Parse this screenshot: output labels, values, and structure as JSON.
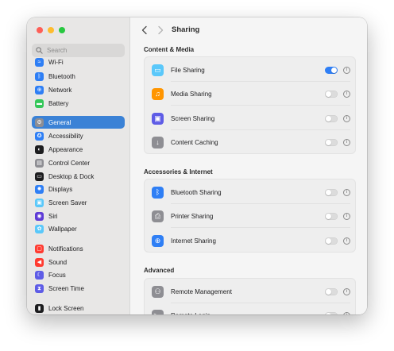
{
  "window": {
    "title": "Sharing"
  },
  "search": {
    "placeholder": "Search"
  },
  "sidebar": {
    "items": [
      {
        "label": "Wi-Fi",
        "icon": "wifi-icon",
        "color": "#2f7ff5",
        "glyph": "≈"
      },
      {
        "label": "Bluetooth",
        "icon": "bluetooth-icon",
        "color": "#2f7ff5",
        "glyph": "ᛒ"
      },
      {
        "label": "Network",
        "icon": "network-icon",
        "color": "#2f7ff5",
        "glyph": "⊕"
      },
      {
        "label": "Battery",
        "icon": "battery-icon",
        "color": "#34c759",
        "glyph": "▬"
      },
      {
        "label": "General",
        "icon": "gear-icon",
        "color": "#8e8e93",
        "glyph": "⚙",
        "selected": true
      },
      {
        "label": "Accessibility",
        "icon": "accessibility-icon",
        "color": "#2f7ff5",
        "glyph": "✪"
      },
      {
        "label": "Appearance",
        "icon": "appearance-icon",
        "color": "#1d1d1f",
        "glyph": "◐"
      },
      {
        "label": "Control Center",
        "icon": "control-center-icon",
        "color": "#8e8e93",
        "glyph": "▤"
      },
      {
        "label": "Desktop & Dock",
        "icon": "desktop-dock-icon",
        "color": "#1d1d1f",
        "glyph": "▭"
      },
      {
        "label": "Displays",
        "icon": "displays-icon",
        "color": "#2f7ff5",
        "glyph": "✹"
      },
      {
        "label": "Screen Saver",
        "icon": "screen-saver-icon",
        "color": "#5ac8fa",
        "glyph": "▣"
      },
      {
        "label": "Siri",
        "icon": "siri-icon",
        "color": "#5e3bd6",
        "glyph": "◉"
      },
      {
        "label": "Wallpaper",
        "icon": "wallpaper-icon",
        "color": "#5ac8fa",
        "glyph": "✿"
      },
      {
        "label": "Notifications",
        "icon": "notifications-icon",
        "color": "#ff3b30",
        "glyph": "▢"
      },
      {
        "label": "Sound",
        "icon": "sound-icon",
        "color": "#ff3b30",
        "glyph": "◀"
      },
      {
        "label": "Focus",
        "icon": "focus-icon",
        "color": "#5e5ce6",
        "glyph": "☾"
      },
      {
        "label": "Screen Time",
        "icon": "screen-time-icon",
        "color": "#5e5ce6",
        "glyph": "⧗"
      },
      {
        "label": "Lock Screen",
        "icon": "lock-screen-icon",
        "color": "#1d1d1f",
        "glyph": "▮"
      }
    ]
  },
  "sections": [
    {
      "title": "Content & Media",
      "rows": [
        {
          "label": "File Sharing",
          "icon": "folder-icon",
          "color": "#5ac8fa",
          "glyph": "▭",
          "on": true
        },
        {
          "label": "Media Sharing",
          "icon": "media-sharing-icon",
          "color": "#ff9500",
          "glyph": "♫",
          "on": false
        },
        {
          "label": "Screen Sharing",
          "icon": "screen-sharing-icon",
          "color": "#5e5ce6",
          "glyph": "▣",
          "on": false
        },
        {
          "label": "Content Caching",
          "icon": "content-caching-icon",
          "color": "#8e8e93",
          "glyph": "↓",
          "on": false
        }
      ]
    },
    {
      "title": "Accessories & Internet",
      "rows": [
        {
          "label": "Bluetooth Sharing",
          "icon": "bluetooth-icon",
          "color": "#2f7ff5",
          "glyph": "ᛒ",
          "on": false
        },
        {
          "label": "Printer Sharing",
          "icon": "printer-icon",
          "color": "#8e8e93",
          "glyph": "⎙",
          "on": false
        },
        {
          "label": "Internet Sharing",
          "icon": "globe-icon",
          "color": "#2f7ff5",
          "glyph": "⊕",
          "on": false
        }
      ]
    },
    {
      "title": "Advanced",
      "rows": [
        {
          "label": "Remote Management",
          "icon": "remote-management-icon",
          "color": "#8e8e93",
          "glyph": "⚇",
          "on": false
        },
        {
          "label": "Remote Login",
          "icon": "remote-login-icon",
          "color": "#8e8e93",
          "glyph": ">_",
          "on": false
        }
      ]
    }
  ]
}
